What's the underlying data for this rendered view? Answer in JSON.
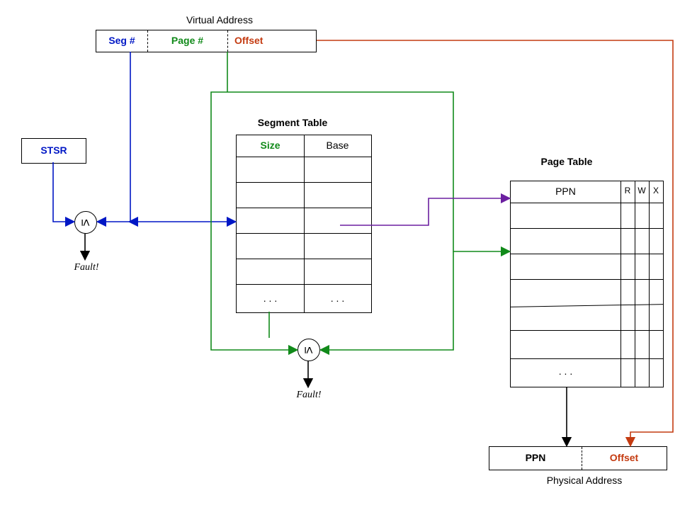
{
  "title": "Virtual Address",
  "va": {
    "seg": "Seg #",
    "page": "Page #",
    "offset": "Offset"
  },
  "stsr": "STSR",
  "cmp": "≤",
  "fault": "Fault!",
  "segtable": {
    "title": "Segment Table",
    "col_size": "Size",
    "col_base": "Base",
    "dots": ". . ."
  },
  "pagetable": {
    "title": "Page Table",
    "ppn": "PPN",
    "r": "R",
    "w": "W",
    "x": "X",
    "dots": ". . ."
  },
  "phys": {
    "ppn": "PPN",
    "offset": "Offset",
    "title": "Physical Address"
  },
  "colors": {
    "blue": "#0017c5",
    "green": "#118a1a",
    "red": "#c43b11",
    "purple": "#6b1fa0",
    "black": "#000000"
  }
}
